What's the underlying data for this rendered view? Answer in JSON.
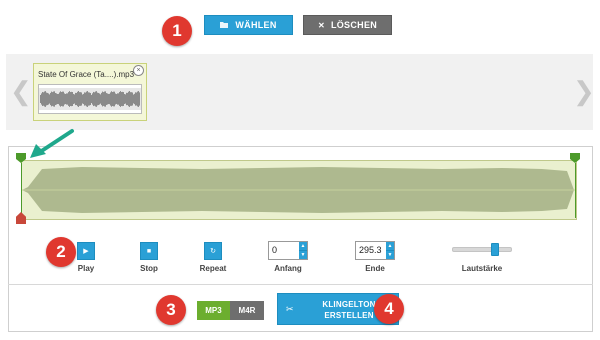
{
  "toolbar": {
    "choose_label": "WÄHLEN",
    "delete_label": "LÖSCHEN",
    "choose_icon": "folder-open-icon",
    "delete_icon": "close-icon"
  },
  "file_strip": {
    "prev_glyph": "❮",
    "next_glyph": "❯",
    "file": {
      "name": "State Of Grace (Ta....).mp3",
      "close_glyph": "×"
    }
  },
  "controls": {
    "play_label": "Play",
    "stop_label": "Stop",
    "repeat_label": "Repeat",
    "start_label": "Anfang",
    "end_label": "Ende",
    "volume_label": "Lautstärke",
    "start_value": "0",
    "end_value": "295.3",
    "volume_level": 0.75
  },
  "output": {
    "format_mp3": "MP3",
    "format_m4r": "M4R",
    "selected_format": "MP3",
    "create_label": "KLINGELTON\nERSTELLEN"
  },
  "annotations": {
    "step1": "1",
    "step2": "2",
    "step3": "3",
    "step4": "4"
  },
  "colors": {
    "accent_blue": "#2aa0d6",
    "badge_red": "#e0382f",
    "mp3_green": "#6cae2f",
    "waveform_fill": "#9aa77a",
    "guide_arrow": "#1fa88c"
  }
}
